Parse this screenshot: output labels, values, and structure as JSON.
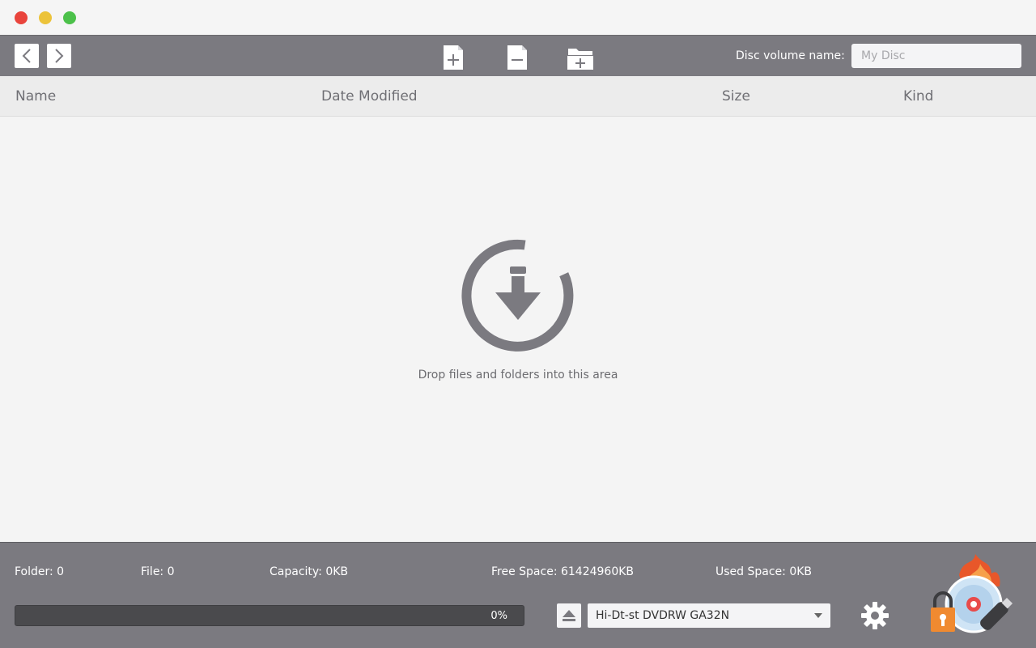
{
  "window": {
    "traffic_lights": [
      "close",
      "minimize",
      "maximize"
    ]
  },
  "toolbar": {
    "back_icon": "chevron-left-icon",
    "forward_icon": "chevron-right-icon",
    "add_file_icon": "add-file-icon",
    "remove_file_icon": "remove-file-icon",
    "add_folder_icon": "add-folder-icon",
    "disc_volume_label": "Disc volume name:",
    "disc_volume_placeholder": "My Disc",
    "disc_volume_value": ""
  },
  "columns": {
    "name": "Name",
    "date_modified": "Date Modified",
    "size": "Size",
    "kind": "Kind"
  },
  "drop_area": {
    "icon": "download-arrow-icon",
    "text": "Drop files and folders into this area"
  },
  "status": {
    "folder": "Folder: 0",
    "file": "File: 0",
    "capacity": "Capacity: 0KB",
    "free_space": "Free Space: 61424960KB",
    "used_space": "Used Space: 0KB"
  },
  "progress": {
    "percent_text": "0%",
    "value": 0
  },
  "drive": {
    "selected": "Hi-Dt-st DVDRW GA32N"
  },
  "colors": {
    "toolbar_bg": "#7b7a80",
    "accent_flame": "#e8572a",
    "lock_orange": "#f08a30"
  }
}
